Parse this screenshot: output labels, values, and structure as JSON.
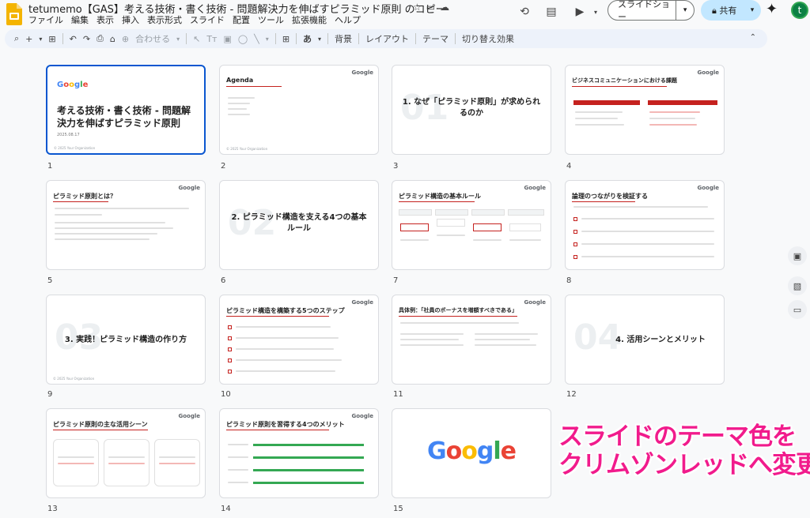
{
  "doc": {
    "title": "tetumemo【GAS】考える技術・書く技術 - 問題解決力を伸ばすピラミッド原則 のコピー"
  },
  "menu": [
    "ファイル",
    "編集",
    "表示",
    "挿入",
    "表示形式",
    "スライド",
    "配置",
    "ツール",
    "拡張機能",
    "ヘルプ"
  ],
  "header": {
    "slideshow_label": "スライドショー",
    "share_label": "共有",
    "avatar_letter": "t"
  },
  "toolbar": {
    "zoom_label": "合わせる",
    "ime_label": "あ",
    "background": "背景",
    "layout": "レイアウト",
    "theme": "テーマ",
    "transition": "切り替え効果"
  },
  "slides": [
    {
      "num": "1",
      "title": "考える技術・書く技術 - 問題解決力を伸ばすピラミッド原則",
      "date": "2025.08.17",
      "logo": "Google"
    },
    {
      "num": "2",
      "title": "Agenda",
      "logo": "Google"
    },
    {
      "num": "3",
      "big": "01",
      "title": "1. なぜ「ピラミッド原則」が求められるのか"
    },
    {
      "num": "4",
      "title": "ビジネスコミュニケーションにおける課題",
      "logo": "Google"
    },
    {
      "num": "5",
      "title": "ピラミッド原則とは？",
      "logo": "Google"
    },
    {
      "num": "6",
      "big": "02",
      "title": "2. ピラミッド構造を支える4つの基本ルール"
    },
    {
      "num": "7",
      "title": "ピラミッド構造の基本ルール",
      "logo": "Google"
    },
    {
      "num": "8",
      "title": "論理のつながりを検証する",
      "logo": "Google"
    },
    {
      "num": "9",
      "big": "03",
      "title": "3. 実践！ピラミッド構造の作り方"
    },
    {
      "num": "10",
      "title": "ピラミッド構造を構築する5つのステップ",
      "logo": "Google"
    },
    {
      "num": "11",
      "title": "具体例：「社員のボーナスを増額すべきである」",
      "logo": "Google"
    },
    {
      "num": "12",
      "big": "04",
      "title": "4. 活用シーンとメリット"
    },
    {
      "num": "13",
      "title": "ピラミッド原則の主な活用シーン",
      "logo": "Google"
    },
    {
      "num": "14",
      "title": "ピラミッド原則を習得する4つのメリット",
      "logo": "Google"
    },
    {
      "num": "15",
      "logo_big": "Google"
    }
  ],
  "annotation": {
    "line1": "スライドのテーマ色を",
    "line2": "クリムゾンレッドへ変更"
  },
  "colors": {
    "accent_red": "#c5221f",
    "annotation_pink": "#f11b8c",
    "selected_blue": "#0b57d0",
    "share_blue": "#c2e7ff"
  }
}
